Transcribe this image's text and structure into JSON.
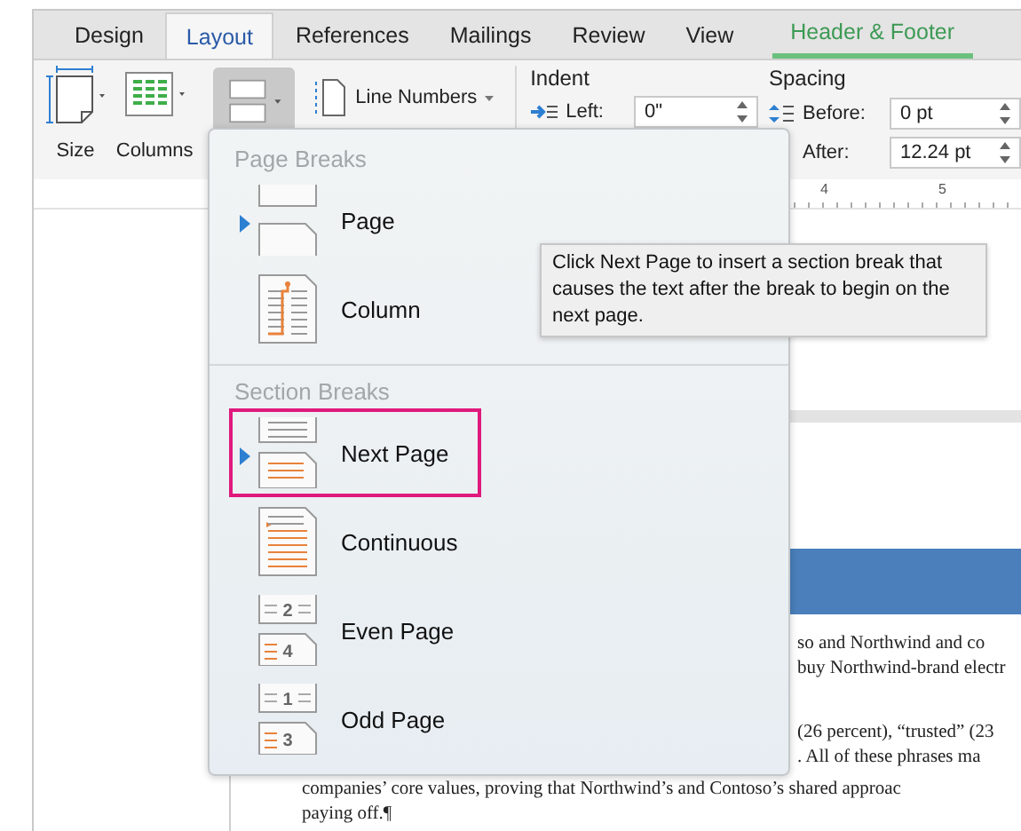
{
  "tabs": [
    {
      "label": "Design",
      "selected": false,
      "kind": "normal"
    },
    {
      "label": "Layout",
      "selected": true,
      "kind": "normal"
    },
    {
      "label": "References",
      "selected": false,
      "kind": "normal"
    },
    {
      "label": "Mailings",
      "selected": false,
      "kind": "normal"
    },
    {
      "label": "Review",
      "selected": false,
      "kind": "normal"
    },
    {
      "label": "View",
      "selected": false,
      "kind": "normal"
    },
    {
      "label": "Header & Footer",
      "selected": false,
      "kind": "contextual"
    }
  ],
  "ribbon": {
    "size_button": {
      "label": "Size"
    },
    "columns_button": {
      "label": "Columns"
    },
    "breaks_button": {
      "pressed": true
    },
    "line_numbers_button": {
      "label": "Line Numbers"
    },
    "indent": {
      "title": "Indent",
      "left": {
        "label": "Left:",
        "value": "0\""
      }
    },
    "spacing": {
      "title": "Spacing",
      "before": {
        "label": "Before:",
        "value": "0 pt"
      },
      "after": {
        "label": "After:",
        "value": "12.24 pt"
      }
    }
  },
  "ruler": {
    "marks": [
      "4",
      "5"
    ]
  },
  "breaks_menu": {
    "sections": [
      {
        "title": "Page Breaks",
        "items": [
          {
            "label": "Page",
            "kind": "page",
            "pointer": true,
            "highlighted": false
          },
          {
            "label": "Column",
            "kind": "column",
            "pointer": false,
            "highlighted": false
          }
        ]
      },
      {
        "title": "Section Breaks",
        "items": [
          {
            "label": "Next Page",
            "kind": "next",
            "pointer": true,
            "highlighted": true
          },
          {
            "label": "Continuous",
            "kind": "continuous",
            "pointer": false,
            "highlighted": false
          },
          {
            "label": "Even Page",
            "kind": "numbered",
            "numbers": [
              "2",
              "4"
            ],
            "pointer": false,
            "highlighted": false
          },
          {
            "label": "Odd Page",
            "kind": "numbered",
            "numbers": [
              "1",
              "3"
            ],
            "pointer": false,
            "highlighted": false
          }
        ]
      }
    ]
  },
  "tooltip": {
    "text": "Click Next Page to insert a section break that causes the text after the break to begin on the next page."
  },
  "document": {
    "paragraphs": [
      {
        "kind": "fragment",
        "lines": [
          "so and Northwind and co",
          "buy Northwind-brand electr"
        ]
      },
      {
        "kind": "fragment",
        "lines": [
          "(26 percent), “trusted” (23",
          ". All of these phrases ma"
        ]
      },
      {
        "kind": "full",
        "lines": [
          "companies’ core values, proving that Northwind’s and Contoso’s shared approac",
          "paying off.¶"
        ]
      }
    ]
  }
}
